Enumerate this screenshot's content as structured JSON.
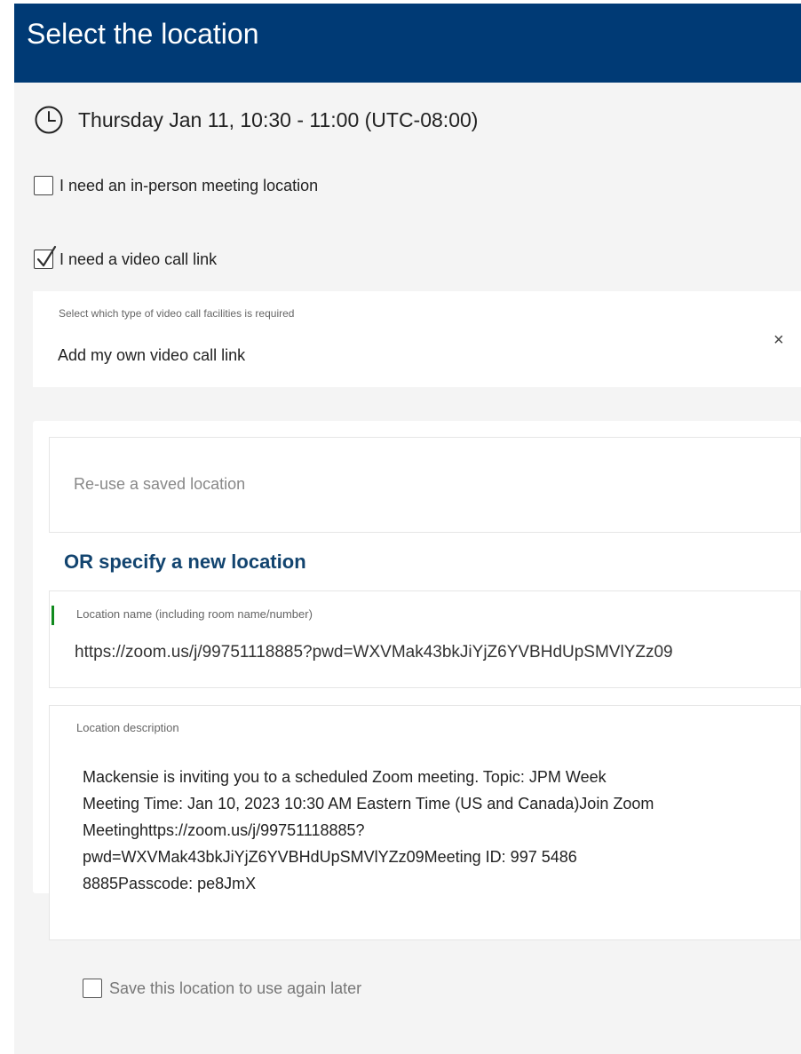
{
  "header": {
    "title": "Select the location"
  },
  "time": {
    "icon": "clock-icon",
    "text": "Thursday Jan 11, 10:30 - 11:00 (UTC-08:00)"
  },
  "options": {
    "in_person": {
      "label": "I need an in-person meeting location",
      "checked": false
    },
    "video": {
      "label": "I need a video call link",
      "checked": true
    }
  },
  "video_select": {
    "caption": "Select which type of video call facilities is required",
    "value": "Add my own video call link",
    "clear": "×"
  },
  "reuse": {
    "placeholder": "Re-use a saved location"
  },
  "new_location": {
    "heading": "OR specify a new location",
    "name_caption": "Location name (including room name/number)",
    "name_value": "https://zoom.us/j/99751118885?pwd=WXVMak43bkJiYjZ6YVBHdUpSMVlYZz09",
    "desc_caption": "Location description",
    "desc_lines": [
      "Mackensie is inviting you to a scheduled Zoom meeting. Topic: JPM Week",
      "Meeting Time: Jan 10, 2023 10:30 AM Eastern Time (US and Canada)Join Zoom",
      "Meetinghttps://zoom.us/j/99751118885?",
      "pwd=WXVMak43bkJiYjZ6YVBHdUpSMVlYZz09Meeting ID: 997 5486",
      "8885Passcode: pe8JmX"
    ]
  },
  "save": {
    "label": "Save this location to use again later",
    "checked": false
  },
  "colors": {
    "header_bg": "#003a75",
    "heading": "#12446f",
    "focus_bar": "#118a1e"
  }
}
